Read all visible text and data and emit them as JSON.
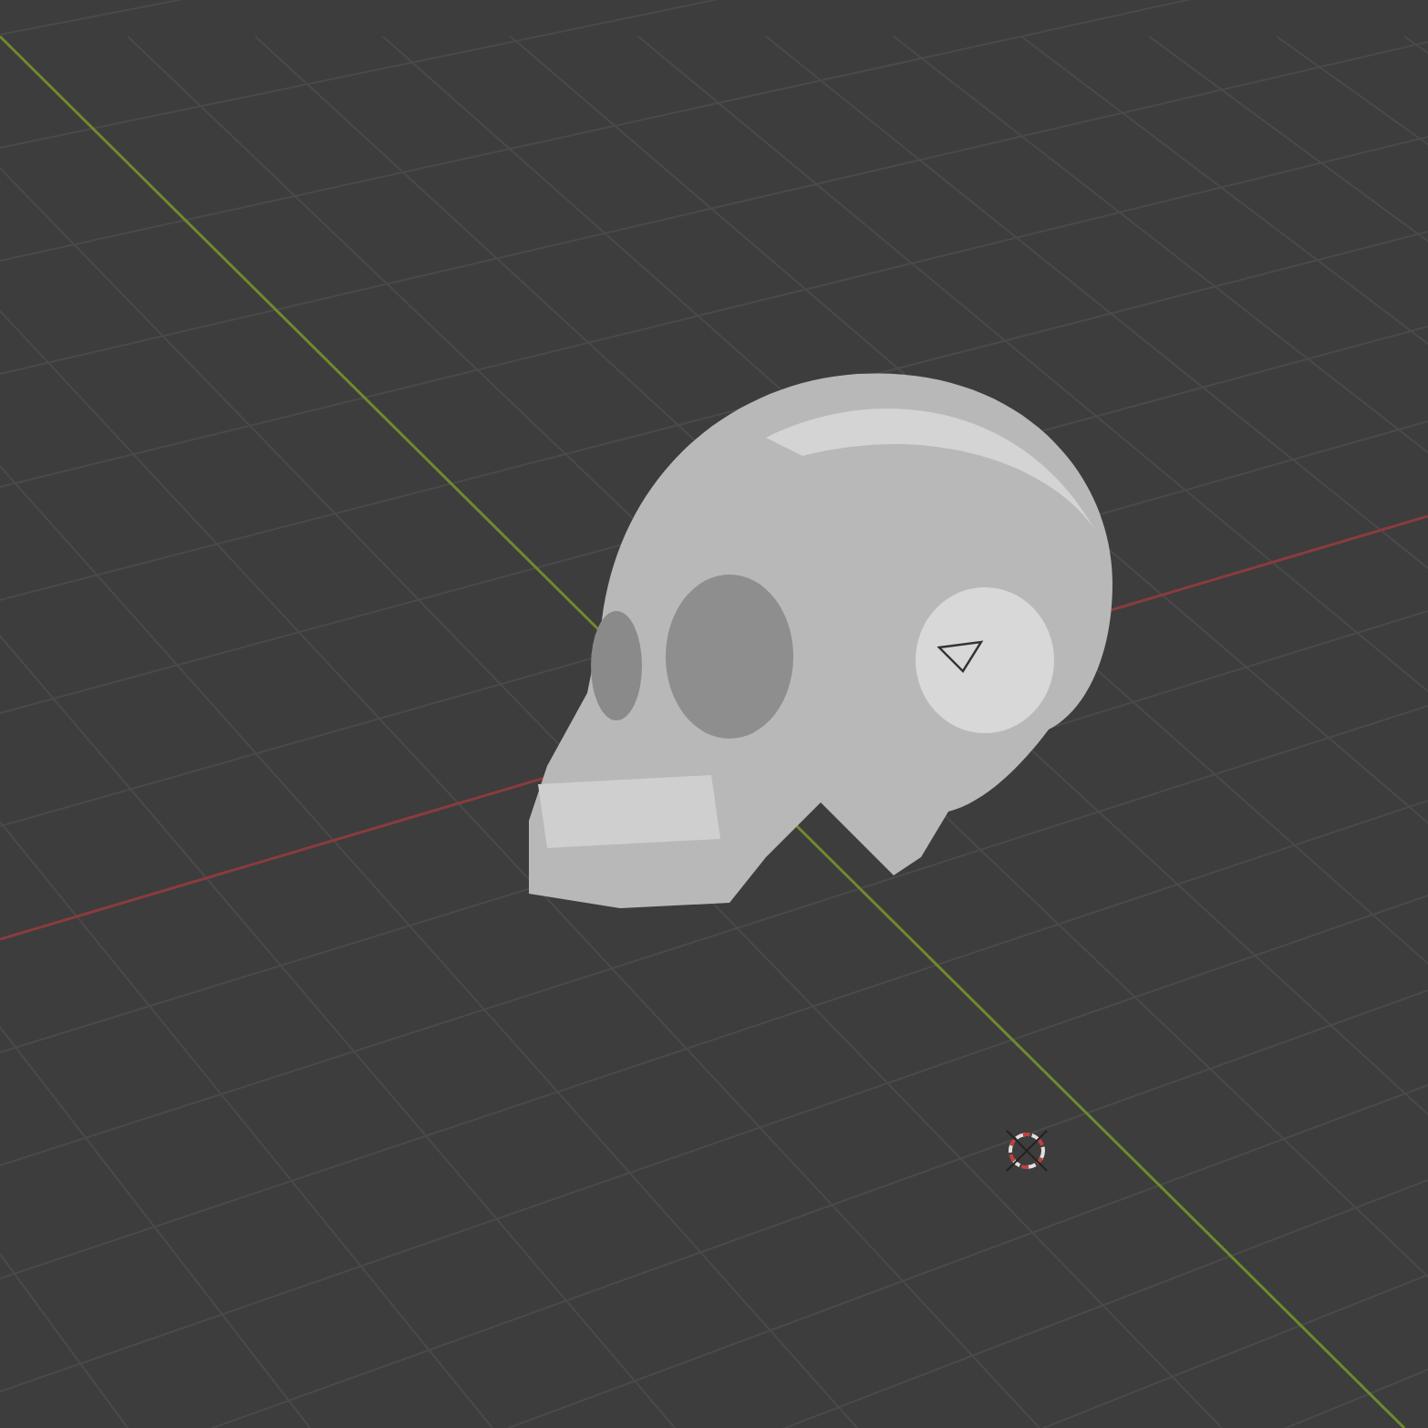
{
  "viewport": {
    "grid": true,
    "axes": true,
    "cursor_3d": true
  }
}
